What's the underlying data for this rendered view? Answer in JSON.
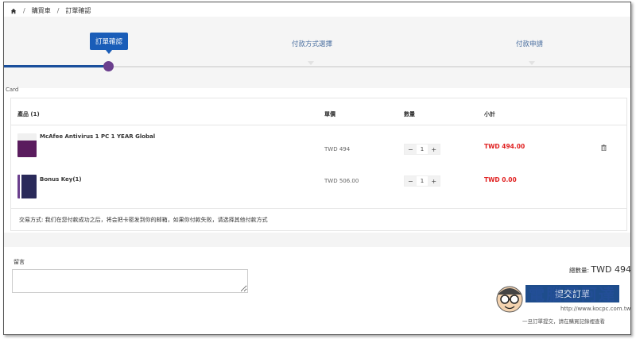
{
  "breadcrumb": {
    "items": [
      "購買車",
      "訂單確認"
    ],
    "separator": "/"
  },
  "stepper": {
    "steps": [
      {
        "label": "訂單確認",
        "active": true
      },
      {
        "label": "付款方式選擇",
        "active": false
      },
      {
        "label": "付款申請",
        "active": false
      }
    ],
    "colors": {
      "active": "#1a5db8",
      "progress": "#1a4f9c",
      "dot": "#6b3f8e"
    }
  },
  "card_label": "Card",
  "cart": {
    "headers": {
      "product": "產品 (1)",
      "unit_price": "單價",
      "quantity": "數量",
      "subtotal": "小計"
    },
    "items": [
      {
        "name": "McAfee Antivirus 1 PC 1 YEAR Global",
        "unit_price": "TWD 494",
        "quantity": "1",
        "subtotal": "TWD 494.00"
      },
      {
        "name": "Bonus Key(1)",
        "unit_price": "TWD 506.00",
        "quantity": "1",
        "subtotal": "TWD 0.00"
      }
    ],
    "minus": "−",
    "plus": "+",
    "trade_note": "交易方式: 我们在您付款成功之后，将会把卡密发到你的邮箱，如果你付款失败，请选择其他付款方式"
  },
  "message": {
    "label": "留言",
    "value": ""
  },
  "summary": {
    "total_label": "總數量:",
    "total_value": "TWD 494",
    "submit_label": "提交訂單",
    "after_note": "一旦訂單提交，請在購買記錄裡查看"
  },
  "watermark": {
    "brand": "電腦王阿達",
    "url": "http://www.kocpc.com.tw"
  },
  "colors": {
    "price_red": "#e02020",
    "submit_blue": "#1e4d8c"
  }
}
